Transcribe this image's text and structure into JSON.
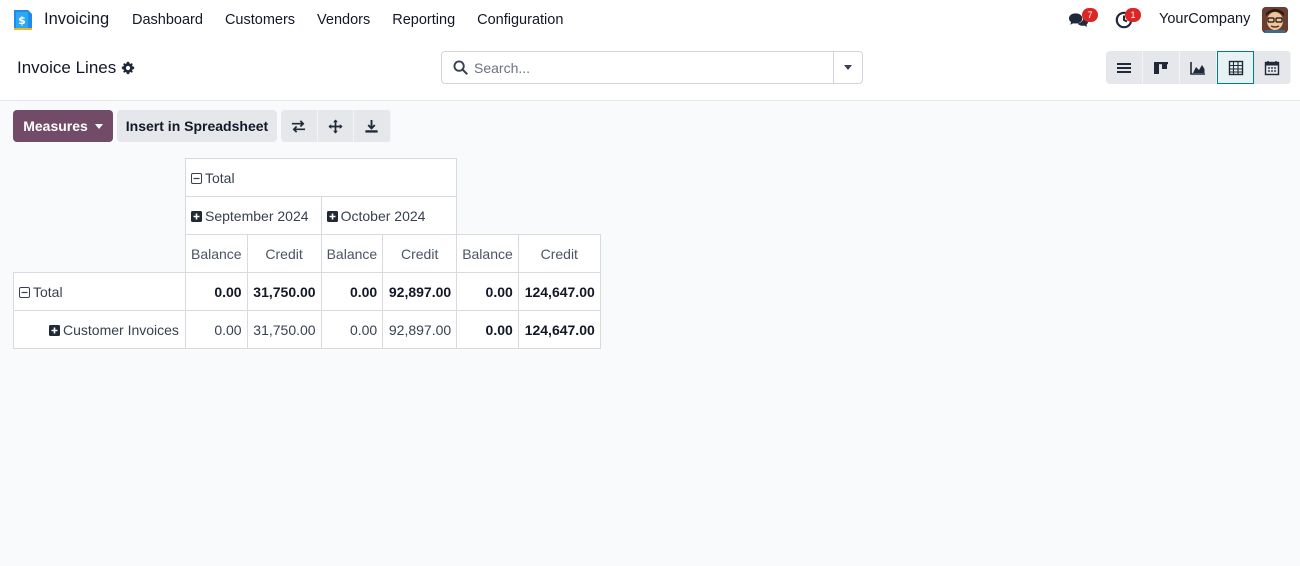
{
  "nav": {
    "app_name": "Invoicing",
    "menu": [
      "Dashboard",
      "Customers",
      "Vendors",
      "Reporting",
      "Configuration"
    ],
    "messages_badge": "7",
    "activities_badge": "1",
    "company": "YourCompany",
    "brand_color": "#714b67"
  },
  "control_panel": {
    "title": "Invoice Lines",
    "search_placeholder": "Search..."
  },
  "toolbar": {
    "measures_label": "Measures",
    "spreadsheet_label": "Insert in Spreadsheet"
  },
  "pivot": {
    "col_total": "Total",
    "col_groups": [
      "September 2024",
      "October 2024"
    ],
    "measures": [
      "Balance",
      "Credit",
      "Balance",
      "Credit",
      "Balance",
      "Credit"
    ],
    "rows": [
      {
        "label": "Total",
        "values": [
          "0.00",
          "31,750.00",
          "0.00",
          "92,897.00",
          "0.00",
          "124,647.00"
        ]
      },
      {
        "label": "Customer Invoices",
        "values": [
          "0.00",
          "31,750.00",
          "0.00",
          "92,897.00",
          "0.00",
          "124,647.00"
        ]
      }
    ]
  }
}
